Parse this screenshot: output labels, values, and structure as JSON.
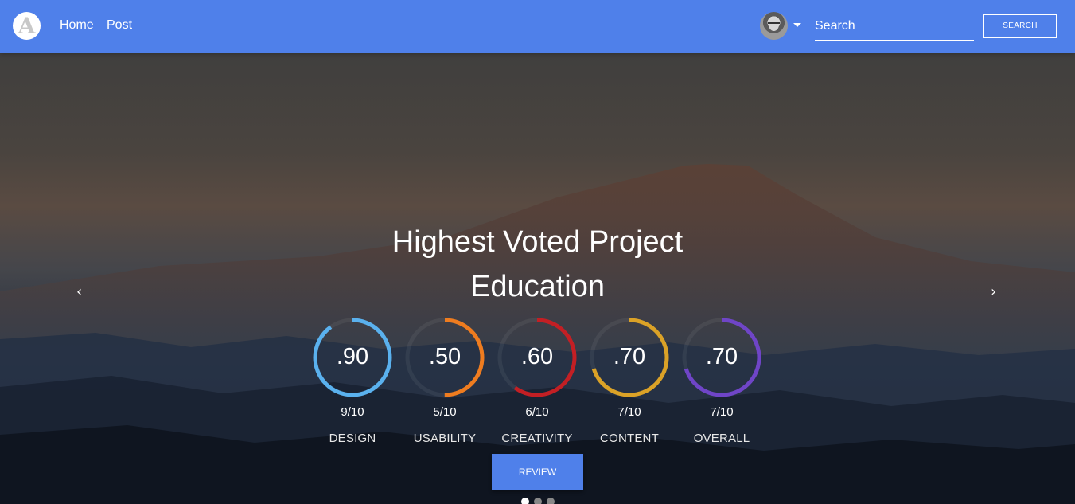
{
  "brand": {
    "logo_letter": "A"
  },
  "nav": {
    "home": "Home",
    "post": "Post"
  },
  "search": {
    "placeholder": "Search",
    "button_label": "SEARCH"
  },
  "hero": {
    "title_line1": "Highest Voted Project",
    "title_line2": "Education",
    "prev_arrow": "‹",
    "next_arrow": "›",
    "review_label": "REVIEW",
    "slides": {
      "count": 3,
      "active_index": 0
    }
  },
  "metrics": [
    {
      "value_text": ".90",
      "fraction": "9/10",
      "label": "DESIGN",
      "score": 0.9,
      "color": "#5ab1ee"
    },
    {
      "value_text": ".50",
      "fraction": "5/10",
      "label": "USABILITY",
      "score": 0.5,
      "color": "#ef7c1f"
    },
    {
      "value_text": ".60",
      "fraction": "6/10",
      "label": "CREATIVITY",
      "score": 0.6,
      "color": "#c31f24"
    },
    {
      "value_text": ".70",
      "fraction": "7/10",
      "label": "CONTENT",
      "score": 0.7,
      "color": "#dba227"
    },
    {
      "value_text": ".70",
      "fraction": "7/10",
      "label": "OVERALL",
      "score": 0.7,
      "color": "#6f45c7"
    }
  ],
  "colors": {
    "navbar": "#4f80ea",
    "accent": "#4f80ea"
  }
}
